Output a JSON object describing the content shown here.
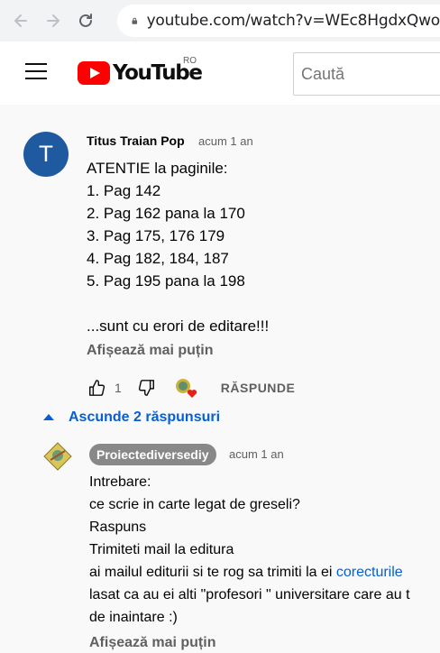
{
  "browser": {
    "url": "youtube.com/watch?v=WEc8HgdxQwo"
  },
  "header": {
    "logo_text": "YouTube",
    "country_code": "RO",
    "search_placeholder": "Caută"
  },
  "comment": {
    "author": "Titus Traian Pop",
    "avatar_letter": "T",
    "avatar_color": "#1f5aa0",
    "time": "acum 1 an",
    "text": "ATENTIE la paginile:\n1. Pag 142\n2. Pag 162 pana la 170\n3. Pag 175, 176 179\n4. Pag 182, 184, 187\n5. Pag 195 pana la 198\n\n...sunt cu erori de editare!!!",
    "show_less": "Afișează mai puțin",
    "like_count": "1",
    "reply_label": "RĂSPUNDE",
    "hide_replies": "Ascunde 2 răspunsuri"
  },
  "reply": {
    "author": "Proiectediversediy",
    "time": "acum 1 an",
    "lines": [
      "Intrebare:",
      "ce scrie in carte legat de greseli?",
      "Raspuns",
      "Trimiteti mail la editura",
      "ai mailul editurii si te rog sa trimiti la ei "
    ],
    "link_text": "corecturile",
    "lines_after": [
      "lasat ca au ei alti \"profesori \" universitare care au t",
      "de inaintare  :)"
    ],
    "show_less": "Afișează mai puțin"
  },
  "colors": {
    "link_blue": "#065fd4",
    "brand_red": "#ff0000",
    "badge_gray": "#888888"
  }
}
